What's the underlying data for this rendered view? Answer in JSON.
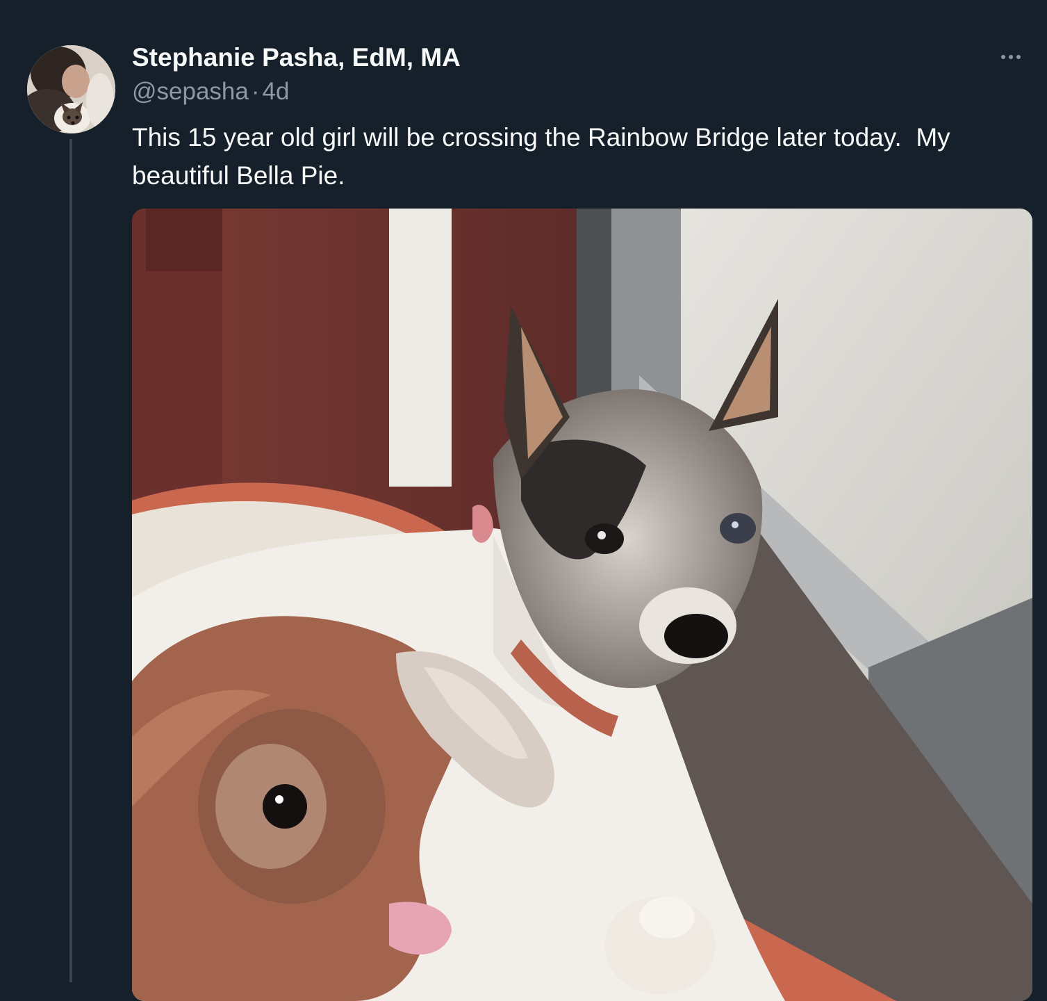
{
  "tweet": {
    "author_name": "Stephanie Pasha, EdM, MA",
    "handle": "@sepasha",
    "separator": "·",
    "time": "4d",
    "text": "This 15 year old girl will be crossing the Rainbow Bridge later today.  My beautiful Bella Pie.",
    "more_icon": "more-horizontal-icon"
  },
  "colors": {
    "background": "#15202b",
    "primary_text": "#f7f9f9",
    "secondary_text": "#8b98a5",
    "thread_line": "#38444d"
  }
}
